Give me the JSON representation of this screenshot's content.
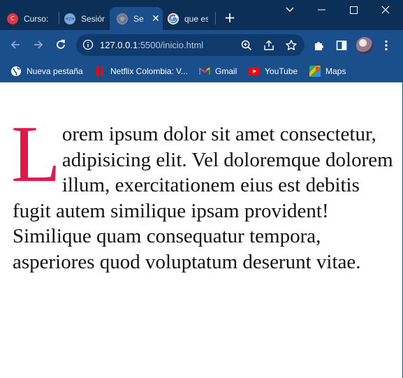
{
  "tabs": [
    {
      "title": "Curso:",
      "icon": "circle-c-icon",
      "color": "#e3343f"
    },
    {
      "title": "Sesión",
      "icon": "code-icon",
      "color": "#7aa7d8"
    },
    {
      "title": "Se",
      "icon": "globe-icon",
      "color": "#8a93a3",
      "active": true
    },
    {
      "title": "que es",
      "icon": "google-icon",
      "color": "#ffffff"
    }
  ],
  "address_bar": {
    "host": "127.0.0.1",
    "rest": ":5500/inicio.html"
  },
  "bookmarks": [
    {
      "label": "Nueva pestaña",
      "icon": "globe-icon"
    },
    {
      "label": "Netflix Colombia: V...",
      "icon": "netflix-icon"
    },
    {
      "label": "Gmail",
      "icon": "gmail-icon"
    },
    {
      "label": "YouTube",
      "icon": "youtube-icon"
    },
    {
      "label": "Maps",
      "icon": "maps-icon"
    }
  ],
  "content": {
    "dropcap": "L",
    "text": "orem ipsum dolor sit amet consectetur, adipisicing elit. Vel doloremque dolorem illum, exercitationem eius est debitis fugit autem similique ipsam provident! Similique quam consequatur tempora, asperiores quod voluptatum deserunt vitae.",
    "dropcap_color": "#e0194a"
  },
  "colors": {
    "tabstrip": "#0b2f57",
    "toolbar": "#1a4f8c",
    "omnibox": "#0f3a6b"
  }
}
